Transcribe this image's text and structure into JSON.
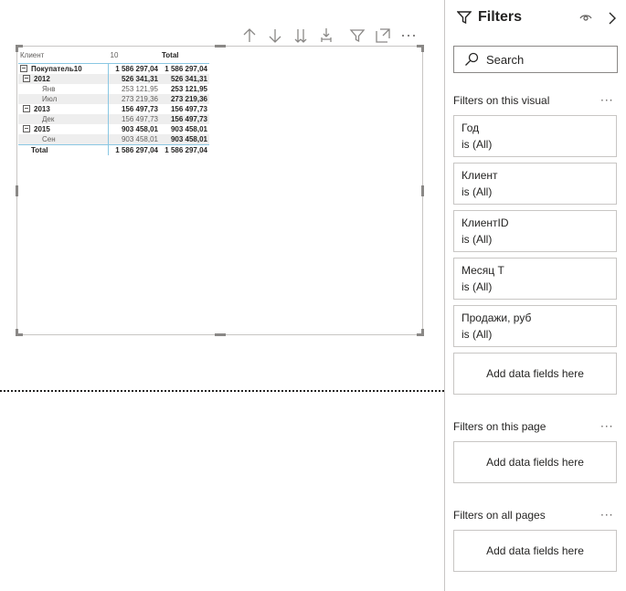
{
  "visual_toolbar": {
    "icons": [
      "arrow-up-icon",
      "arrow-down-icon",
      "double-arrow-down-icon",
      "expand-hierarchy-icon",
      "filter-icon",
      "focus-mode-icon",
      "more-options-icon"
    ]
  },
  "matrix": {
    "headers": {
      "row_field": "Клиент",
      "column_value": "10",
      "total": "Total"
    },
    "rows": [
      {
        "label": "Покупатель10",
        "col": "1 586 297,04",
        "total": "1 586 297,04"
      },
      {
        "label": "2012",
        "col": "526 341,31",
        "total": "526 341,31"
      },
      {
        "label": "Янв",
        "col": "253 121,95",
        "total": "253 121,95"
      },
      {
        "label": "Июл",
        "col": "273 219,36",
        "total": "273 219,36"
      },
      {
        "label": "2013",
        "col": "156 497,73",
        "total": "156 497,73"
      },
      {
        "label": "Дек",
        "col": "156 497,73",
        "total": "156 497,73"
      },
      {
        "label": "2015",
        "col": "903 458,01",
        "total": "903 458,01"
      },
      {
        "label": "Сен",
        "col": "903 458,01",
        "total": "903 458,01"
      },
      {
        "label": "Total",
        "col": "1 586 297,04",
        "total": "1 586 297,04"
      }
    ]
  },
  "filters_pane": {
    "title": "Filters",
    "search_placeholder": "Search",
    "section_visual": "Filters on this visual",
    "visual_filters": [
      {
        "name": "Год",
        "value": "is (All)"
      },
      {
        "name": "Клиент",
        "value": "is (All)"
      },
      {
        "name": "КлиентID",
        "value": "is (All)"
      },
      {
        "name": "Месяц Т",
        "value": "is (All)"
      },
      {
        "name": "Продажи, руб",
        "value": "is (All)"
      }
    ],
    "add_fields_visual": "Add data fields here",
    "section_page": "Filters on this page",
    "add_fields_page": "Add data fields here",
    "section_all": "Filters on all pages",
    "add_fields_all": "Add data fields here",
    "more_label": "···"
  }
}
